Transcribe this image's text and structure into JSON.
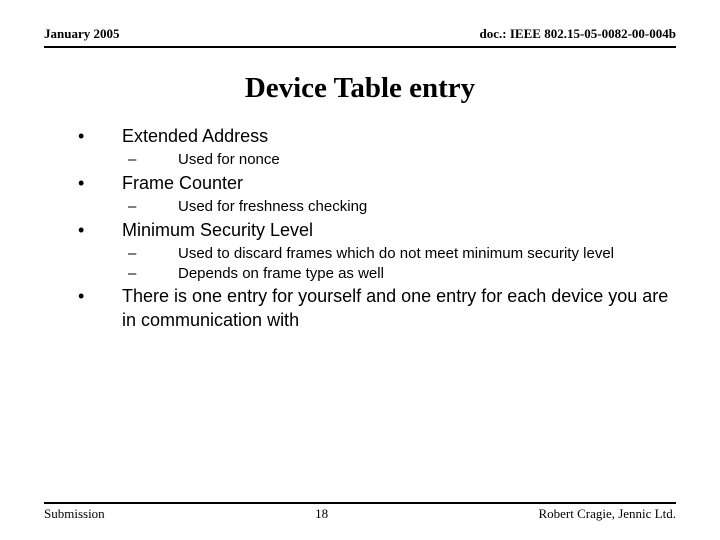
{
  "header": {
    "left": "January 2005",
    "right": "doc.: IEEE 802.15-05-0082-00-004b"
  },
  "title": "Device Table entry",
  "bullets": [
    {
      "text": "Extended Address",
      "sub": [
        "Used for nonce"
      ]
    },
    {
      "text": "Frame Counter",
      "sub": [
        "Used for freshness checking"
      ]
    },
    {
      "text": "Minimum Security Level",
      "sub": [
        "Used to discard frames which do not meet minimum security level",
        "Depends on frame type as well"
      ]
    },
    {
      "text": "There is one entry for yourself and one entry for each device you are in communication with",
      "sub": []
    }
  ],
  "footer": {
    "left": "Submission",
    "center": "18",
    "right": "Robert Cragie, Jennic Ltd."
  }
}
